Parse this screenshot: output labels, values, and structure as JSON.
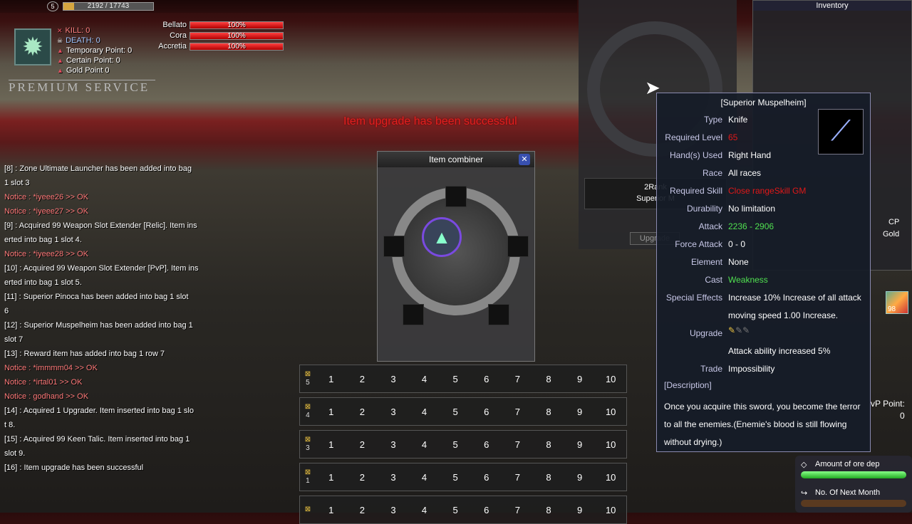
{
  "player": {
    "exp_text": "2192 / 17743",
    "exp_fraction": 0.12,
    "level_badge": "5"
  },
  "stats": {
    "kill": "KILL: 0",
    "death": "DEATH: 0",
    "temporary": "Temporary Point: 0",
    "certain": "Certain Point: 0",
    "gold": "Gold Point 0"
  },
  "premium": "PREMIUM SERVICE",
  "races": [
    {
      "name": "Bellato",
      "value": "100%"
    },
    {
      "name": "Cora",
      "value": "100%"
    },
    {
      "name": "Accretia",
      "value": "100%"
    }
  ],
  "system_message": "Item upgrade has been successful",
  "chat": [
    {
      "text": "[8] : Zone Ultimate Launcher has been added into bag",
      "notice": false
    },
    {
      "text": "1 slot 3",
      "notice": false
    },
    {
      "text": "Notice : *iyeee26 >> OK",
      "notice": true
    },
    {
      "text": "Notice : *iyeee27 >> OK",
      "notice": true
    },
    {
      "text": "[9] : Acquired 99 Weapon Slot Extender [Relic]. Item ins",
      "notice": false
    },
    {
      "text": "erted into bag 1 slot 4.",
      "notice": false
    },
    {
      "text": "Notice : *iyeee28 >> OK",
      "notice": true
    },
    {
      "text": "[10] : Acquired 99 Weapon Slot Extender [PvP]. Item ins",
      "notice": false
    },
    {
      "text": "erted into bag 1 slot 5.",
      "notice": false
    },
    {
      "text": "[11] : Superior Pinoca has been added into bag 1 slot",
      "notice": false
    },
    {
      "text": "6",
      "notice": false
    },
    {
      "text": "[12] : Superior Muspelheim has been added into bag 1",
      "notice": false
    },
    {
      "text": " slot 7",
      "notice": false
    },
    {
      "text": "[13] : Reward item has added into bag 1 row 7",
      "notice": false
    },
    {
      "text": "Notice : *immmm04 >> OK",
      "notice": true
    },
    {
      "text": "Notice : *irtal01 >> OK",
      "notice": true
    },
    {
      "text": "Notice : godhand >> OK",
      "notice": true
    },
    {
      "text": "[14] : Acquired 1 Upgrader. Item inserted into bag 1 slo",
      "notice": false
    },
    {
      "text": "t 8.",
      "notice": false
    },
    {
      "text": "[15] : Acquired 99 Keen Talic. Item inserted into bag 1",
      "notice": false
    },
    {
      "text": "slot 9.",
      "notice": false
    },
    {
      "text": "[16] : Item upgrade has been successful",
      "notice": false
    }
  ],
  "combiner": {
    "title": "Item combiner",
    "close": "✕"
  },
  "hotbars": [
    {
      "label": "5",
      "keys": [
        "1",
        "2",
        "3",
        "4",
        "5",
        "6",
        "7",
        "8",
        "9",
        "10"
      ]
    },
    {
      "label": "4",
      "keys": [
        "1",
        "2",
        "3",
        "4",
        "5",
        "6",
        "7",
        "8",
        "9",
        "10"
      ]
    },
    {
      "label": "3",
      "keys": [
        "1",
        "2",
        "3",
        "4",
        "5",
        "6",
        "7",
        "8",
        "9",
        "10"
      ]
    },
    {
      "label": "1",
      "keys": [
        "1",
        "2",
        "3",
        "4",
        "5",
        "6",
        "7",
        "8",
        "9",
        "10"
      ]
    },
    {
      "label": "",
      "keys": [
        "1",
        "2",
        "3",
        "4",
        "5",
        "6",
        "7",
        "8",
        "9",
        "10"
      ]
    }
  ],
  "upgrade_panel": {
    "rank": "2Rank",
    "item": "Superior M",
    "button": "Upgrade"
  },
  "inventory": {
    "title": "Inventory",
    "cp": "CP",
    "gold": "Gold",
    "pvp": "vP Point:",
    "pvp_value": "0",
    "stack": "98"
  },
  "tooltip": {
    "name": "[Superior Muspelheim]",
    "rows": [
      {
        "k": "Type",
        "v": "Knife",
        "c": ""
      },
      {
        "k": "Required Level",
        "v": "65",
        "c": "red"
      },
      {
        "k": "Hand(s) Used",
        "v": "Right Hand",
        "c": ""
      },
      {
        "k": "Race",
        "v": "All races",
        "c": ""
      },
      {
        "k": "Required Skill",
        "v": "Close rangeSkill GM",
        "c": "red"
      },
      {
        "k": "Durability",
        "v": "No limitation",
        "c": ""
      },
      {
        "k": "Attack",
        "v": "2236 - 2906",
        "c": "grn"
      },
      {
        "k": "Force Attack",
        "v": "0 - 0",
        "c": ""
      },
      {
        "k": "Element",
        "v": "None",
        "c": ""
      },
      {
        "k": "Cast",
        "v": "Weakness",
        "c": "grn"
      },
      {
        "k": "Special Effects",
        "v": "Increase 10% Increase of all attack",
        "c": ""
      },
      {
        "k": "",
        "v": "moving speed 1.00 Increase.",
        "c": ""
      },
      {
        "k": "Upgrade",
        "v": "",
        "c": ""
      },
      {
        "k": "",
        "v": "Attack ability increased 5%",
        "c": ""
      },
      {
        "k": "Trade",
        "v": "Impossibility",
        "c": ""
      }
    ],
    "upgrade_level": 1,
    "upgrade_slots": 3,
    "desc_title": "[Description]",
    "description": [
      "Once you acquire this sword, you become the terror",
      "to all the enemies.(Enemie's blood is still flowing",
      "without drying.)"
    ]
  },
  "ore": {
    "amount": "Amount of ore dep",
    "amount_fraction": 1.0,
    "next": "No. Of Next Month"
  }
}
